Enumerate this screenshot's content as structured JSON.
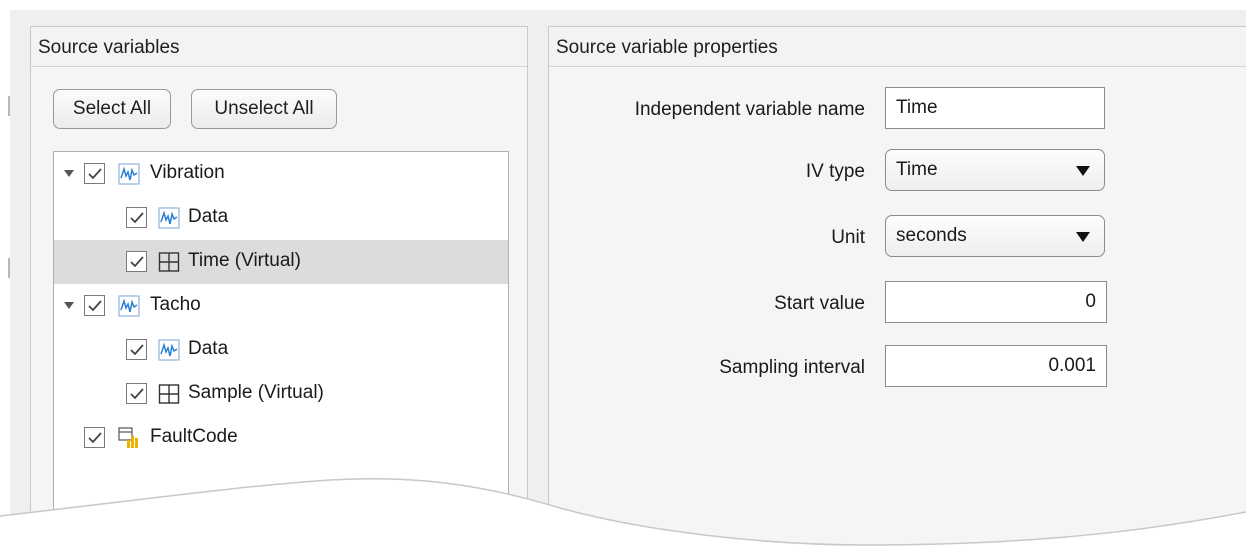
{
  "left_panel": {
    "title": "Source variables",
    "select_all_label": "Select All",
    "unselect_all_label": "Unselect All",
    "tree": [
      {
        "label": "Vibration",
        "icon": "signal-icon",
        "checked": true,
        "expanded": true,
        "level": 0
      },
      {
        "label": "Data",
        "icon": "signal-icon",
        "checked": true,
        "level": 1
      },
      {
        "label": "Time (Virtual)",
        "icon": "table-icon",
        "checked": true,
        "level": 1,
        "selected": true
      },
      {
        "label": "Tacho",
        "icon": "signal-icon",
        "checked": true,
        "expanded": true,
        "level": 0
      },
      {
        "label": "Data",
        "icon": "signal-icon",
        "checked": true,
        "level": 1
      },
      {
        "label": "Sample (Virtual)",
        "icon": "table-icon",
        "checked": true,
        "level": 1
      },
      {
        "label": "FaultCode",
        "icon": "condition-variable-icon",
        "checked": true,
        "level": 0
      }
    ]
  },
  "right_panel": {
    "title": "Source variable properties",
    "iv_name_label": "Independent variable name",
    "iv_name_value": "Time",
    "iv_type_label": "IV type",
    "iv_type_value": "Time",
    "unit_label": "Unit",
    "unit_value": "seconds",
    "start_value_label": "Start value",
    "start_value": "0",
    "sampling_interval_label": "Sampling interval",
    "sampling_interval_value": "0.001"
  },
  "colors": {
    "panel_bg": "#f5f5f5",
    "selected_row": "#dcdcdc",
    "signal_icon_blue": "#2a7fd4",
    "fault_icon_yellow": "#e8b400"
  }
}
